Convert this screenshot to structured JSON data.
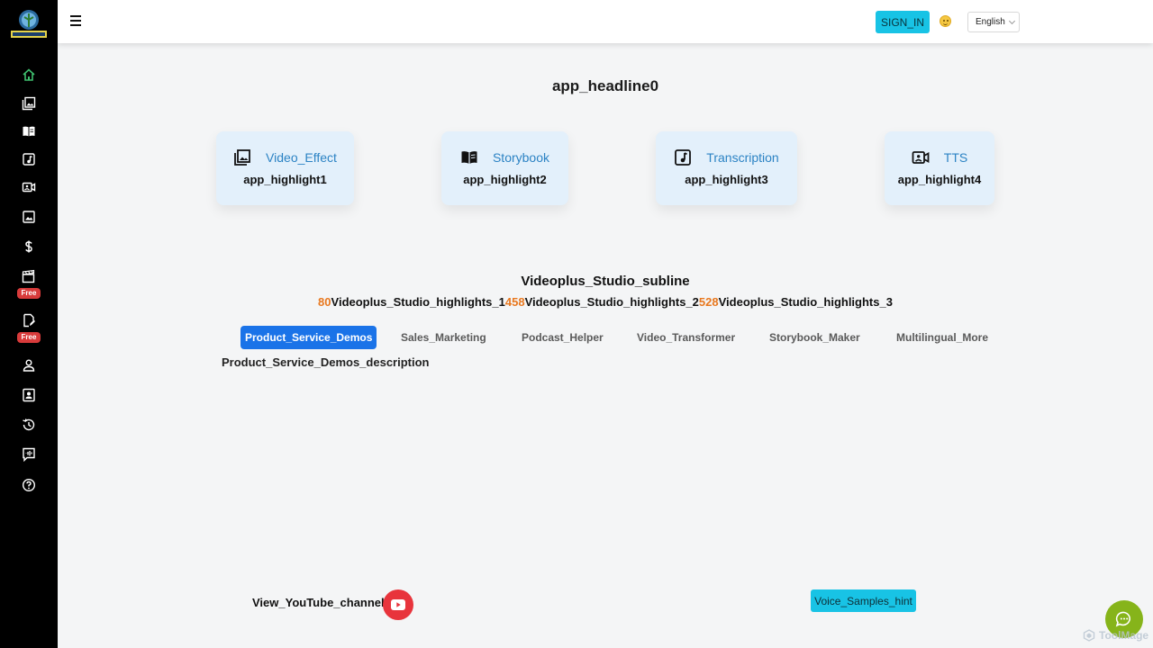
{
  "sidebar": {
    "logo_alt": "vTransformer",
    "items": [
      {
        "icon": "home-icon",
        "color": "#3fbf6f"
      },
      {
        "icon": "gallery-icon"
      },
      {
        "icon": "book-icon"
      },
      {
        "icon": "music-note-icon"
      },
      {
        "icon": "video-camera-icon"
      },
      {
        "icon": "image-icon"
      },
      {
        "icon": "dollar-icon"
      },
      {
        "icon": "clapperboard-icon",
        "badge": "Free"
      },
      {
        "icon": "document-edit-icon",
        "badge": "Free"
      },
      {
        "icon": "person-icon"
      },
      {
        "icon": "contact-card-icon"
      },
      {
        "icon": "history-icon"
      },
      {
        "icon": "voice-icon"
      },
      {
        "icon": "help-icon"
      }
    ]
  },
  "header": {
    "sign_in_label": "SIGN_IN",
    "language": "English"
  },
  "main": {
    "headline": "app_headline0",
    "highlights": [
      {
        "title": "Video_Effect",
        "subtitle": "app_highlight1",
        "icon": "gallery-icon"
      },
      {
        "title": "Storybook",
        "subtitle": "app_highlight2",
        "icon": "book-icon"
      },
      {
        "title": "Transcription",
        "subtitle": "app_highlight3",
        "icon": "music-note-icon"
      },
      {
        "title": "TTS",
        "subtitle": "app_highlight4",
        "icon": "video-camera-icon"
      }
    ],
    "subline": "Videoplus_Studio_subline",
    "stats": [
      {
        "number": "80",
        "label": "Videoplus_Studio_highlights_1"
      },
      {
        "number": "458",
        "label": "Videoplus_Studio_highlights_2"
      },
      {
        "number": "528",
        "label": "Videoplus_Studio_highlights_3"
      }
    ],
    "tabs": [
      {
        "label": "Product_Service_Demos",
        "active": true
      },
      {
        "label": "Sales_Marketing"
      },
      {
        "label": "Podcast_Helper"
      },
      {
        "label": "Video_Transformer"
      },
      {
        "label": "Storybook_Maker"
      },
      {
        "label": "Multilingual_More"
      }
    ],
    "tab_description": "Product_Service_Demos_description",
    "youtube_label": "View_YouTube_channel",
    "voice_hint_label": "Voice_Samples_hint"
  },
  "watermark": "ToolMage",
  "colors": {
    "accent_blue": "#1a73e8",
    "cyan": "#18c3e5",
    "orange": "#e8781f",
    "youtube_red": "#e8343c",
    "chat_green": "#86b41a",
    "card_bg": "#e3f0fb"
  }
}
